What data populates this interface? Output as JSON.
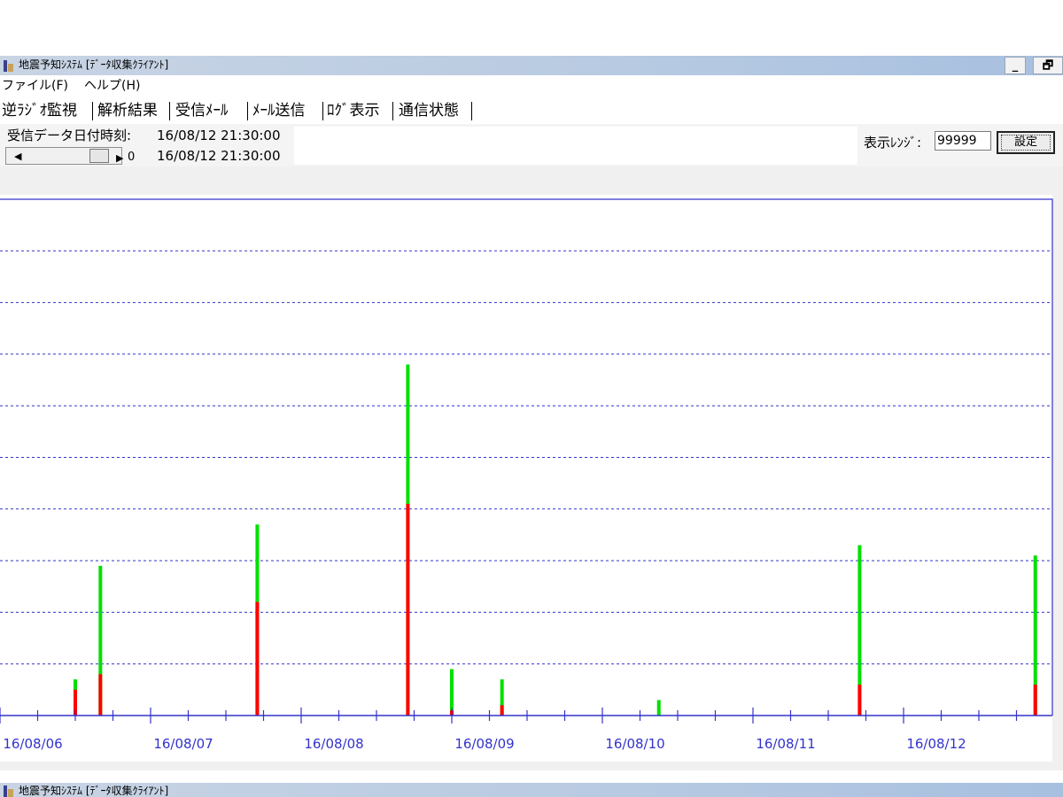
{
  "window": {
    "title": "地震予知ｼｽﾃﾑ [ﾃﾞｰﾀ収集ｸﾗｲｱﾝﾄ]",
    "minimize_label": "_",
    "restore_label": "🗗"
  },
  "menu": {
    "items": [
      "ファイル(F)",
      "ヘルプ(H)"
    ]
  },
  "tabs": [
    "逆ﾗｼﾞｵ監視",
    "解析結果",
    "受信ﾒｰﾙ",
    "ﾒｰﾙ送信",
    "ﾛｸﾞ表示",
    "通信状態"
  ],
  "info": {
    "received_label": "受信データ日付時刻:",
    "received_value": "16/08/12 21:30:00",
    "slider_value": "0",
    "slider_time": "16/08/12 21:30:00",
    "range_label": "表示ﾚﾝｼﾞ:",
    "range_value": "99999",
    "set_button": "設定"
  },
  "colors": {
    "frame": "#3333cc",
    "series_green": "#00e000",
    "series_red": "#ff0000",
    "axis": "#3333cc"
  },
  "chart_data": {
    "type": "bar",
    "title": "",
    "xlabel": "",
    "ylabel": "",
    "x_ticks": [
      "16/08/06",
      "16/08/07",
      "16/08/08",
      "16/08/09",
      "16/08/10",
      "16/08/11",
      "16/08/12"
    ],
    "grid": "horizontal dashed",
    "ylim": [
      0,
      10
    ],
    "series": [
      {
        "color": "green",
        "x": [
          "16/08/06 12:00",
          "16/08/06 16:00",
          "16/08/07 17:00",
          "16/08/08 17:00",
          "16/08/09 00:00",
          "16/08/09 08:00",
          "16/08/10 09:00",
          "16/08/11 17:00",
          "16/08/12 21:00"
        ],
        "values": [
          0.7,
          2.9,
          3.7,
          6.8,
          0.9,
          0.7,
          0.3,
          3.3,
          3.1
        ]
      },
      {
        "color": "red",
        "x": [
          "16/08/06 12:00",
          "16/08/06 16:00",
          "16/08/07 17:00",
          "16/08/08 17:00",
          "16/08/09 00:00",
          "16/08/09 08:00",
          "16/08/10 09:00",
          "16/08/11 17:00",
          "16/08/12 21:00"
        ],
        "values": [
          0.5,
          0.8,
          2.2,
          4.1,
          0.1,
          0.2,
          0.0,
          0.6,
          0.6
        ]
      }
    ]
  }
}
